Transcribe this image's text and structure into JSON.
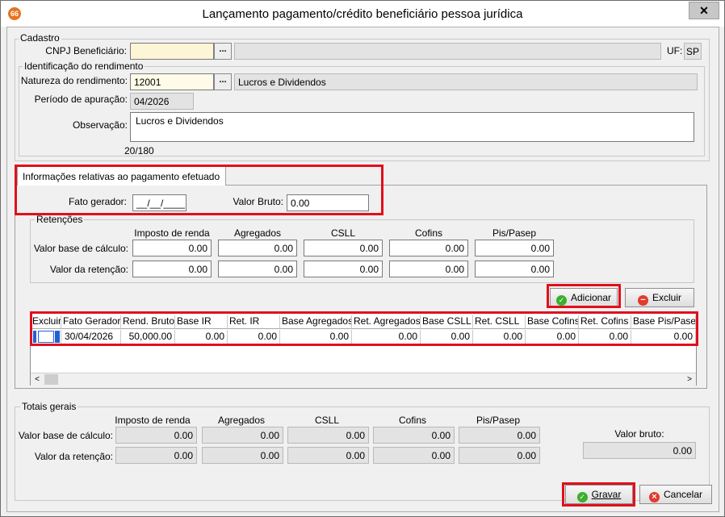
{
  "window": {
    "title": "Lançamento pagamento/crédito beneficiário pessoa jurídica",
    "app_icon_text": "66",
    "close_symbol": "✕"
  },
  "cadastro": {
    "legend": "Cadastro",
    "cnpj_label": "CNPJ Beneficiário:",
    "cnpj_value": "",
    "cnpj_name_value": "",
    "lookup_symbol": "...",
    "uf_label": "UF:",
    "uf_value": "SP"
  },
  "identificacao": {
    "legend": "Identificação do rendimento",
    "natureza_label": "Natureza do rendimento:",
    "natureza_code": "12001",
    "natureza_desc": "Lucros e Dividendos",
    "periodo_label": "Período de apuração:",
    "periodo_value": "04/2026",
    "observacao_label": "Observação:",
    "observacao_value": "Lucros e Dividendos",
    "char_count": "20/180"
  },
  "pagamento": {
    "tab_label": "Informações relativas ao pagamento efetuado",
    "fato_gerador_label": "Fato gerador:",
    "fato_gerador_value": "__/__/____",
    "valor_bruto_label": "Valor Bruto:",
    "valor_bruto_value": "0.00"
  },
  "retencoes": {
    "legend": "Retenções",
    "columns": [
      "Imposto de renda",
      "Agregados",
      "CSLL",
      "Cofins",
      "Pis/Pasep"
    ],
    "row_base_label": "Valor base de cálculo:",
    "row_ret_label": "Valor da retenção:",
    "base_values": [
      "0.00",
      "0.00",
      "0.00",
      "0.00",
      "0.00"
    ],
    "ret_values": [
      "0.00",
      "0.00",
      "0.00",
      "0.00",
      "0.00"
    ]
  },
  "actions": {
    "adicionar": "Adicionar",
    "excluir": "Excluir",
    "gravar": "Gravar",
    "cancelar": "Cancelar"
  },
  "grid": {
    "headers": [
      "Excluir",
      "Fato Gerador",
      "Rend. Bruto",
      "Base IR",
      "Ret. IR",
      "Base Agregados",
      "Ret. Agregados",
      "Base CSLL",
      "Ret. CSLL",
      "Base Cofins",
      "Ret. Cofins",
      "Base Pis/Pasep"
    ],
    "rows": [
      [
        "",
        "30/04/2026",
        "50,000.00",
        "0.00",
        "0.00",
        "0.00",
        "0.00",
        "0.00",
        "0.00",
        "0.00",
        "0.00",
        "0.00"
      ]
    ],
    "scroll_left": "<",
    "scroll_right": ">"
  },
  "totais": {
    "legend": "Totais gerais",
    "columns": [
      "Imposto de renda",
      "Agregados",
      "CSLL",
      "Cofins",
      "Pis/Pasep"
    ],
    "row_base_label": "Valor base de cálculo:",
    "row_ret_label": "Valor da retenção:",
    "base_values": [
      "0.00",
      "0.00",
      "0.00",
      "0.00",
      "0.00"
    ],
    "ret_values": [
      "0.00",
      "0.00",
      "0.00",
      "0.00",
      "0.00"
    ],
    "valor_bruto_label": "Valor bruto:",
    "valor_bruto_value": "0.00"
  },
  "colors": {
    "highlight_red": "#e0101c",
    "window_bg": "#f0f0f0",
    "readonly_bg": "#e3e3e3",
    "cnpj_bg": "#fcf5d6"
  }
}
